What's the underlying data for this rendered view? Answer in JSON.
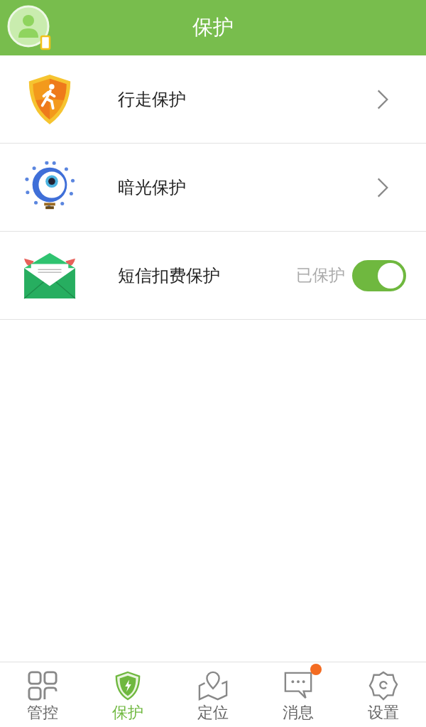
{
  "header": {
    "title": "保护"
  },
  "items": [
    {
      "kind": "link",
      "label": "行走保护"
    },
    {
      "kind": "link",
      "label": "暗光保护"
    },
    {
      "kind": "toggle",
      "label": "短信扣费保护",
      "status": "已保护",
      "on": true
    }
  ],
  "tabs": [
    {
      "label": "管控",
      "selected": false,
      "badge": false
    },
    {
      "label": "保护",
      "selected": true,
      "badge": false
    },
    {
      "label": "定位",
      "selected": false,
      "badge": false
    },
    {
      "label": "消息",
      "selected": false,
      "badge": true
    },
    {
      "label": "设置",
      "selected": false,
      "badge": false
    }
  ]
}
